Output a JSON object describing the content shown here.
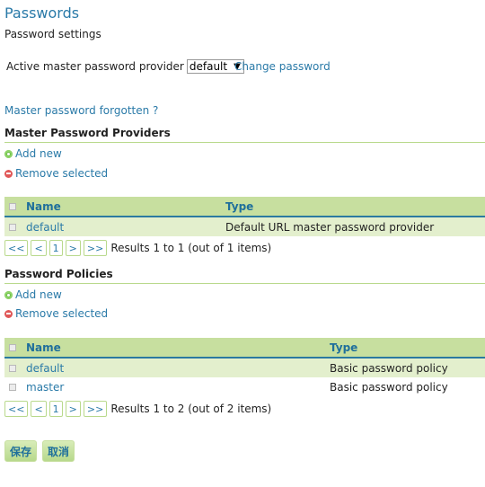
{
  "header": {
    "title": "Passwords",
    "subtitle": "Password settings"
  },
  "master_provider": {
    "label": "Active master password provider",
    "selected": "default",
    "change_password_link": "Change password",
    "forgotten_link": "Master password forgotten ?"
  },
  "providers_section": {
    "title": "Master Password Providers",
    "add_label": "Add new",
    "remove_label": "Remove selected",
    "columns": [
      "Name",
      "Type"
    ],
    "rows": [
      {
        "name": "default",
        "type": "Default URL master password provider"
      }
    ],
    "pager": {
      "first": "<<",
      "prev": "<",
      "page": "1",
      "next": ">",
      "last": ">>",
      "results": "Results 1 to 1 (out of 1 items)"
    }
  },
  "policies_section": {
    "title": "Password Policies",
    "add_label": "Add new",
    "remove_label": "Remove selected",
    "columns": [
      "Name",
      "Type"
    ],
    "rows": [
      {
        "name": "default",
        "type": "Basic password policy"
      },
      {
        "name": "master",
        "type": "Basic password policy"
      }
    ],
    "pager": {
      "first": "<<",
      "prev": "<",
      "page": "1",
      "next": ">",
      "last": ">>",
      "results": "Results 1 to 2 (out of 2 items)"
    }
  },
  "footer": {
    "save_label": "保存",
    "cancel_label": "取消"
  },
  "colors": {
    "link": "#2a7aa8",
    "header_bg": "#c7df9f",
    "row_odd_bg": "#e3efcd",
    "section_rule": "#b9d98c"
  }
}
